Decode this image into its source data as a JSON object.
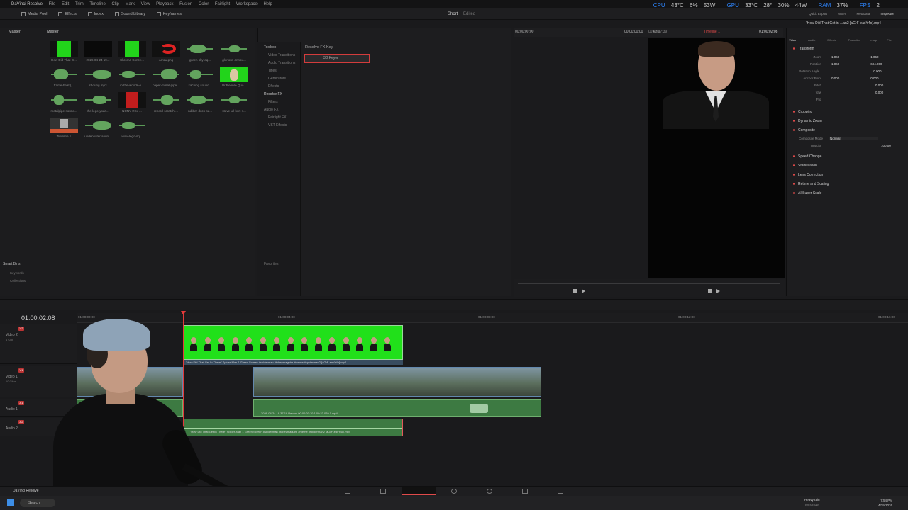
{
  "menubar": {
    "app": "DaVinci Resolve",
    "items": [
      "File",
      "Edit",
      "Trim",
      "Timeline",
      "Clip",
      "Mark",
      "View",
      "Playback",
      "Fusion",
      "Color",
      "Fairlight",
      "Workspace",
      "Help"
    ]
  },
  "system_stats": {
    "cpu_label": "CPU",
    "cpu_temp": "43°C",
    "cpu_load": "6%",
    "cpu_power": "53W",
    "gpu_label": "GPU",
    "gpu_temp": "33°C",
    "gpu_temp2": "28°",
    "gpu_load": "30%",
    "gpu_power": "44W",
    "ram_label": "RAM",
    "ram_val": "37%",
    "fps_label": "FPS",
    "fps_val": "2"
  },
  "toolbar": {
    "media_pool": "Media Pool",
    "effects": "Effects",
    "index": "Index",
    "sound_library": "Sound Library",
    "keyframes": "Keyframes",
    "short": "Short",
    "edited": "Edited",
    "quick_export": "Quick Export",
    "mixer": "Mixer",
    "metadata": "Metadata",
    "inspector": "Inspector"
  },
  "media_pool": {
    "master_label": "Master",
    "bin_label": "Master",
    "smart_bins": "Smart Bins",
    "keywords": "Keywords",
    "collections": "Collections",
    "clips": [
      {
        "caption": "How Did That G..."
      },
      {
        "caption": "2026-04-24 19..."
      },
      {
        "caption": "Chroma Conce..."
      },
      {
        "caption": "Arrow.png"
      },
      {
        "caption": "green-sky-eq..."
      },
      {
        "caption": "glorious-annou..."
      },
      {
        "caption": "frame-beat (..."
      },
      {
        "caption": "st-dung.mp3"
      },
      {
        "caption": "in-the-woods-o..."
      },
      {
        "caption": "paper-metal-pipe..."
      },
      {
        "caption": "kaching sound..."
      },
      {
        "caption": "Ur Reonre Quo..."
      },
      {
        "caption": "metalpipe-sound..."
      },
      {
        "caption": "the-lego-yoda..."
      },
      {
        "caption": "NONY REJ ..."
      },
      {
        "caption": "record-scratch-..."
      },
      {
        "caption": "rubber-duck-sq..."
      },
      {
        "caption": "steve-ull-hurt-s..."
      },
      {
        "caption": "Timeline 1"
      },
      {
        "caption": "underwater-soun..."
      },
      {
        "caption": "wow-lego-sq..."
      }
    ]
  },
  "effects": {
    "search_value": "3d",
    "tree": [
      "Toolbox",
      "Video Transitions",
      "Audio Transitions",
      "Titles",
      "Generators",
      "Effects",
      "Resolve FX",
      "Filters",
      "Audio FX",
      "Fairlight FX",
      "VST Effects"
    ],
    "active_tree_item": "Resolve FX",
    "favorites": "Favorites",
    "category_title": "Resolve FX Key",
    "result_item": "3D Keyer"
  },
  "viewer": {
    "zoom": "40%",
    "src_timecode": "00:00:00:00",
    "rec_timecode_a": "00:00:00:00",
    "duration": "00:01:37:39",
    "timeline_name": "Timeline 1",
    "timeline_timecode": "01:00:02:08"
  },
  "inspector": {
    "clip_title": "\"How Did That Get in ...an2 [aGrF-eaxY4o].mp4",
    "tabs": [
      "Video",
      "Audio",
      "Effects",
      "Transition",
      "Image",
      "File"
    ],
    "transform": "Transform",
    "zoom_label": "Zoom",
    "zoom_x": "1.060",
    "zoom_y": "1.060",
    "position_label": "Position",
    "position_x": "1.060",
    "position_y": "694.000",
    "rotation_label": "Rotation Angle",
    "rotation_val": "0.000",
    "anchor_label": "Anchor Point",
    "anchor_x": "0.000",
    "anchor_y": "0.000",
    "pitch_label": "Pitch",
    "pitch_val": "0.000",
    "yaw_label": "Yaw",
    "yaw_val": "0.000",
    "flip_label": "Flip",
    "sections": [
      "Cropping",
      "Dynamic Zoom",
      "Composite"
    ],
    "composite_mode_label": "Composite Mode",
    "composite_mode": "Normal",
    "opacity_label": "Opacity",
    "opacity_val": "100.00",
    "more_sections": [
      "Speed Change",
      "Stabilization",
      "Lens Correction",
      "Retime and Scaling",
      "AI Super Scale"
    ]
  },
  "timeline": {
    "timecode": "01:00:02:08",
    "ruler_marks": [
      "01:00:00:00",
      "01:00:04:00",
      "01:00:08:00",
      "01:00:12:00",
      "01:00:16:00"
    ],
    "tracks": [
      {
        "tag": "V2",
        "name": "Video 2",
        "sub": "1 Clip"
      },
      {
        "tag": "V1",
        "name": "Video 1",
        "sub": "10 Clips"
      },
      {
        "tag": "A1",
        "name": "Audio 1"
      },
      {
        "tag": "A2",
        "name": "Audio 2"
      }
    ],
    "v2_clip_title": "\"How Did That Get In There\" Spider-Man 1 Green Screen #spiderman #tobeymaguire #meme #spiderman2 [aGrF-eaxY4o].mp4",
    "a1_clip_title": "2026-04-24 19 37 18 Record 00:00:20:10 1 00:23 029 1.mp4",
    "a2_clip_title": "\"How Did That Get In There\" Spider-Man 1 Green Screen #spiderman #tobeymaguire #meme #spiderman2 [aGrF-eaxY4o].mp4"
  },
  "taskbar": {
    "app_label": "DaVinci Resolve",
    "search": "Search",
    "weather_title": "Heavy rain",
    "weather_sub": "Tomorrow",
    "time": "7:54 PM",
    "date": "4/29/2026"
  },
  "colors": {
    "accent_red": "#e23a3a",
    "stat_blue": "#2e86ff",
    "green_screen": "#21e01a",
    "audio_green": "#3d7a42",
    "video_blue": "#2e4860"
  }
}
